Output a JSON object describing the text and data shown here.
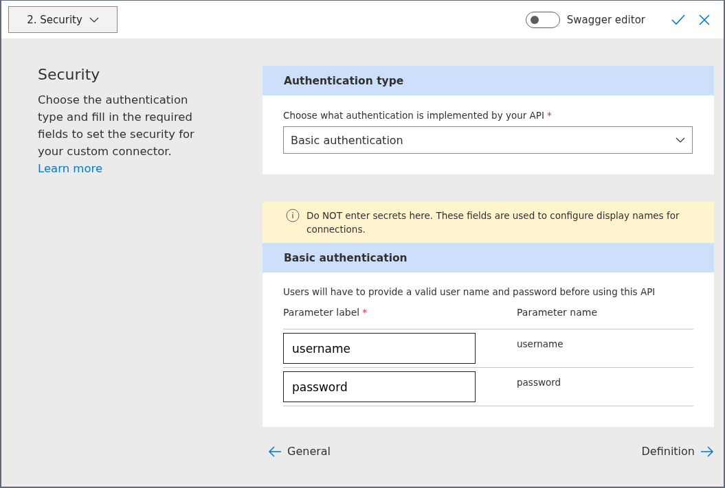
{
  "step_menu": {
    "label": "2. Security"
  },
  "swagger_toggle": {
    "label": "Swagger editor",
    "on": false
  },
  "intro": {
    "title": "Security",
    "text": "Choose the authentication type and fill in the required fields to set the security for your custom connector.",
    "link": "Learn more"
  },
  "auth_type": {
    "heading": "Authentication type",
    "field_label": "Choose what authentication is implemented by your API",
    "required_mark": "*",
    "value": "Basic authentication"
  },
  "notice": "Do NOT enter secrets here. These fields are used to configure display names for connections.",
  "basic_auth": {
    "heading": "Basic authentication",
    "description": "Users will have to provide a valid user name and password before using this API",
    "columns": [
      {
        "label": "Parameter label",
        "required_mark": "*"
      },
      {
        "label": "Parameter name"
      }
    ],
    "rows": [
      {
        "label": "username",
        "name": "username"
      },
      {
        "label": "password",
        "name": "password"
      }
    ]
  },
  "nav": {
    "back": "General",
    "next": "Definition"
  }
}
